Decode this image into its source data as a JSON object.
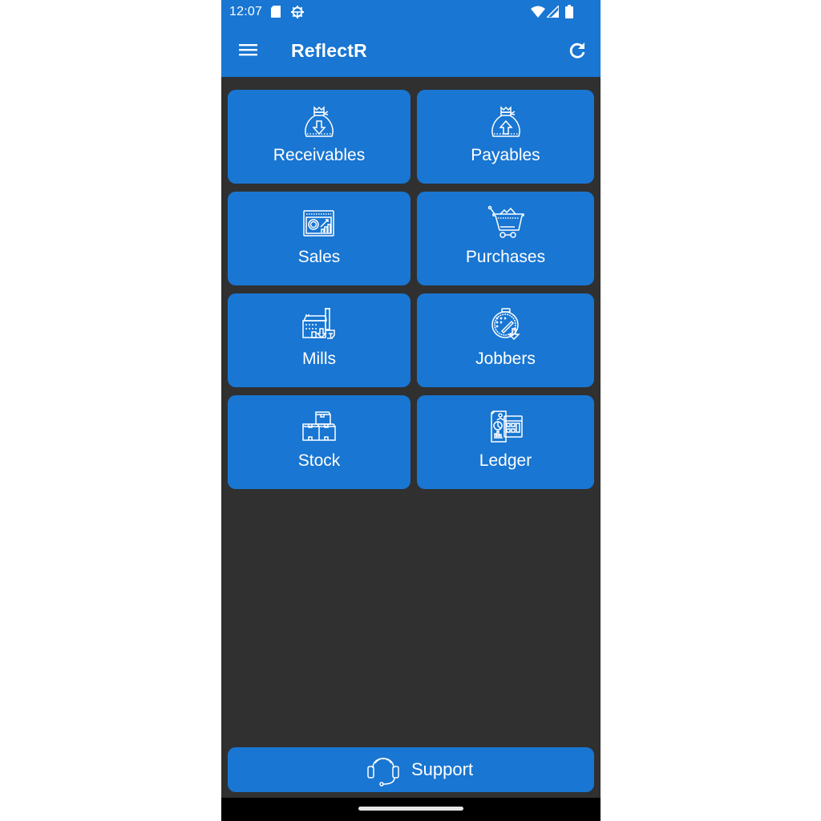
{
  "status_bar": {
    "time": "12:07",
    "icons": [
      "sd-card-icon",
      "settings-gear-icon",
      "wifi-icon",
      "signal-icon",
      "battery-icon"
    ]
  },
  "app_bar": {
    "title": "ReflectR",
    "left_icon": "menu-icon",
    "right_icon": "refresh-icon"
  },
  "tiles": [
    {
      "label": "Receivables",
      "icon": "money-bag-down-icon"
    },
    {
      "label": "Payables",
      "icon": "money-bag-up-icon"
    },
    {
      "label": "Sales",
      "icon": "sales-chart-icon"
    },
    {
      "label": "Purchases",
      "icon": "shopping-cart-icon"
    },
    {
      "label": "Mills",
      "icon": "factory-icon"
    },
    {
      "label": "Jobbers",
      "icon": "embroidery-hoop-icon"
    },
    {
      "label": "Stock",
      "icon": "boxes-icon"
    },
    {
      "label": "Ledger",
      "icon": "ledger-calculator-icon"
    }
  ],
  "support": {
    "label": "Support",
    "icon": "headset-icon"
  },
  "colors": {
    "primary": "#1976d2",
    "background": "#303030",
    "text": "#ffffff"
  }
}
